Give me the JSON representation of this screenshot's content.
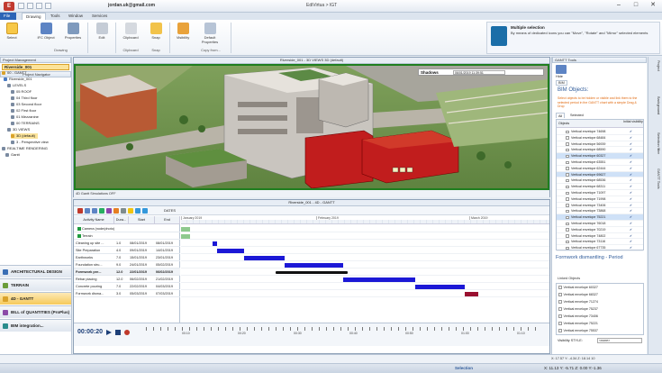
{
  "titlebar": {
    "user_email": "jordan.uk@gmail.com",
    "app_title": "EdiVirtua > IGT",
    "min_glyph": "–",
    "max_glyph": "□",
    "close_glyph": "✕"
  },
  "ribbon_tabs": [
    {
      "label": "File"
    },
    {
      "label": "Drawing"
    },
    {
      "label": "Tools"
    },
    {
      "label": "Window"
    },
    {
      "label": "Services"
    }
  ],
  "ribbon": {
    "select_label": "Select",
    "ifc_label": "IFC Object",
    "properties_label": "Properties",
    "edit_label": "Edit",
    "clipboard_label": "Clipboard",
    "snap_label": "Snap",
    "visibility_label": "Visibility",
    "default_props_label": "Default Properties",
    "drawing_group": "Drawing",
    "clipboard_group": "Clipboard",
    "snap_group": "Snap",
    "copy_group": "Copy from...",
    "info_title": "Multiple selection",
    "info_text": "By means of dedicated icons you can \"Move\", \"Rotate\" and \"Mirror\" selected elements"
  },
  "left_panel": {
    "header": "Project Management",
    "project_name": "Riverside_001",
    "subheader": "Project Navigator",
    "tree": [
      {
        "label": "00 - GANTT",
        "indent": 2,
        "color": "#d9a22b"
      },
      {
        "label": "Riverside_001",
        "indent": 4,
        "color": "#4a7bc3"
      },
      {
        "label": "LEVELS",
        "indent": 8,
        "color": "#7a8aa0"
      },
      {
        "label": "05 ROOF",
        "indent": 12,
        "color": "#7a8aa0"
      },
      {
        "label": "04 Third floor",
        "indent": 12,
        "color": "#7a8aa0"
      },
      {
        "label": "03 Second floor",
        "indent": 12,
        "color": "#7a8aa0"
      },
      {
        "label": "02 First floor",
        "indent": 12,
        "color": "#7a8aa0"
      },
      {
        "label": "01 Mezzanine",
        "indent": 12,
        "color": "#7a8aa0"
      },
      {
        "label": "00 TERRAINS",
        "indent": 12,
        "color": "#7a8aa0"
      },
      {
        "label": "3D VIEWS",
        "indent": 8,
        "color": "#7a8aa0"
      },
      {
        "label": "3D (default)",
        "indent": 12,
        "color": "#d9a22b",
        "selected": true
      },
      {
        "label": "3 - Perspective view",
        "indent": 12,
        "color": "#7a8aa0"
      },
      {
        "label": "REALTIME RENDERING",
        "indent": 2,
        "color": "#7a8aa0"
      },
      {
        "label": "Gantt",
        "indent": 6,
        "color": "#7a8aa0"
      }
    ],
    "nav_buttons": [
      {
        "label": "ARCHITECTURAL DESIGN",
        "color": "#3b6fb5"
      },
      {
        "label": "TERRAIN",
        "color": "#6a9c3a"
      },
      {
        "label": "4D - GANTT",
        "color": "#d9a22b",
        "selected": true
      },
      {
        "label": "BILL of QUANTITIES (ProPlus)",
        "color": "#8b4aa8"
      },
      {
        "label": "BIM integration...",
        "color": "#2a8c8c"
      }
    ]
  },
  "view3d": {
    "title": "Riverside_001 - 3D VIEWS 3D (default)",
    "shadows_label": "Shadows",
    "shadows_value": "06/01/2019 11:39:51",
    "footer": "4D Gantt Simulations OFF"
  },
  "gantt": {
    "title": "Riverside_001 - 4D - GANTT",
    "dates_label": "DATES",
    "columns": [
      "Activity Name",
      "Dura...",
      "Start",
      "End"
    ],
    "months": [
      "January 2019",
      "February 2019",
      "March 2019"
    ],
    "rows": [
      {
        "name": "Camera (node/photo)",
        "dur": "",
        "start": "",
        "end": "",
        "kind": "check"
      },
      {
        "name": "Terrain",
        "dur": "",
        "start": "",
        "end": "",
        "kind": "check"
      },
      {
        "name": "Cleaning up site ...",
        "dur": "1.0",
        "start": "08/01/2019",
        "end": "08/01/2019",
        "kind": "task"
      },
      {
        "name": "Site Preparation",
        "dur": "4.0",
        "start": "09/01/2019",
        "end": "14/01/2019",
        "kind": "task"
      },
      {
        "name": "Earthworks",
        "dur": "7.0",
        "start": "15/01/2019",
        "end": "23/01/2019",
        "kind": "task"
      },
      {
        "name": "Foundation stru...",
        "dur": "9.0",
        "start": "24/01/2019",
        "end": "05/02/2019",
        "kind": "task"
      },
      {
        "name": "Formwork pre...",
        "dur": "12.0",
        "start": "22/01/2019",
        "end": "06/02/2019",
        "kind": "group"
      },
      {
        "name": "Rebar placing",
        "dur": "12.0",
        "start": "06/02/2019",
        "end": "21/02/2019",
        "kind": "task"
      },
      {
        "name": "Concrete pouring",
        "dur": "7.0",
        "start": "22/02/2019",
        "end": "04/03/2019",
        "kind": "task"
      },
      {
        "name": "Formwork disma...",
        "dur": "3.0",
        "start": "05/03/2019",
        "end": "07/03/2019",
        "kind": "task"
      }
    ],
    "time": "00:00:20",
    "ruler_labels": [
      "00:10",
      "00:20",
      "00:30",
      "00:40",
      "00:50",
      "01:00",
      "01:10"
    ]
  },
  "right_panel": {
    "header": "GANTT Tools",
    "tool_label": "Hide",
    "tab_label": "BIM",
    "bim_title": "BIM Objects:",
    "bim_desc": "Select objects to be hidden or visible and link them to the selected period in the GANTT chart with a simple Drag & Drop",
    "tabs": [
      "All",
      "Selected"
    ],
    "col_objects": "Objects",
    "col_visibility": "Initial visibility",
    "objects": [
      {
        "name": "Vertical envelope 74698",
        "sel": false
      },
      {
        "name": "Vertical envelope 68484",
        "sel": false
      },
      {
        "name": "Vertical envelope 56939",
        "sel": false
      },
      {
        "name": "Vertical envelope 68590",
        "sel": false
      },
      {
        "name": "Vertical envelope 60327",
        "sel": true
      },
      {
        "name": "Vertical envelope 63551",
        "sel": false
      },
      {
        "name": "Vertical envelope 62444",
        "sel": false
      },
      {
        "name": "Vertical envelope 69627",
        "sel": true
      },
      {
        "name": "Vertical envelope 68536",
        "sel": false
      },
      {
        "name": "Vertical envelope 68311",
        "sel": false
      },
      {
        "name": "Vertical envelope 71097",
        "sel": false
      },
      {
        "name": "Vertical envelope 71998",
        "sel": false
      },
      {
        "name": "Vertical envelope 73406",
        "sel": false
      },
      {
        "name": "Vertical envelope 73868",
        "sel": false
      },
      {
        "name": "Vertical envelope 75221",
        "sel": true
      },
      {
        "name": "Vertical envelope 76018",
        "sel": false
      },
      {
        "name": "Vertical envelope 70219",
        "sel": false
      },
      {
        "name": "Vertical envelope 74802",
        "sel": false
      },
      {
        "name": "Vertical envelope 73116",
        "sel": false
      },
      {
        "name": "Vertical envelope 67735",
        "sel": false
      }
    ],
    "vis_glyph": "✔",
    "period_title": "Formwork dismantling - Period",
    "linked_label": "Linked Objects",
    "linked": [
      "Vertical envelope 60327",
      "Vertical envelope 68327",
      "Vertical envelope 71274",
      "Vertical envelope 75237",
      "Vertical envelope 73406",
      "Vertical envelope 75221",
      "Vertical envelope 75537"
    ],
    "vis_style_label": "Visibility STYLE:",
    "vis_style_value": "<none>"
  },
  "right_strip": [
    "Project",
    "Background",
    "Selection filter",
    "GANTT Tools"
  ],
  "status": {
    "coords_top": "X: 17.57   Y: -4.34   Z: 18.14   10",
    "selection_label": "Selection",
    "coords": "X: 11.13   Y: -5.71   Z: 0.00   Y:-1.36"
  },
  "colors": {
    "bar_blue": "#1c18d6",
    "accent_red": "#9a1030",
    "selection_yellow": "#fbe39a"
  }
}
